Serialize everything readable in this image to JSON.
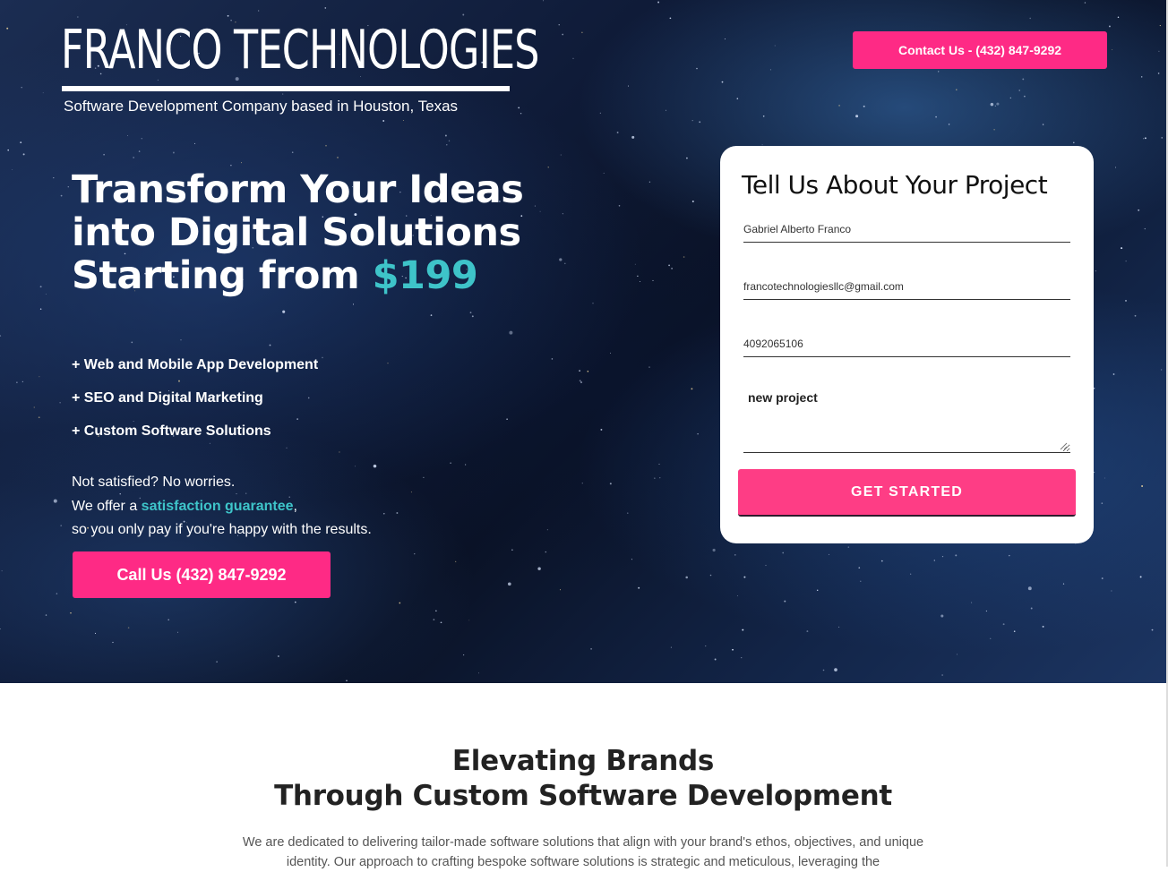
{
  "brand": {
    "name": "FRANCO TECHNOLOGIES",
    "tagline": "Software Development Company based in Houston, Texas"
  },
  "header": {
    "contact_label": "Contact Us - (432) 847-9292"
  },
  "hero": {
    "heading_line1": "Transform Your Ideas",
    "heading_line2": "into Digital Solutions",
    "heading_line3_prefix": "Starting from ",
    "heading_price": "$199",
    "services": [
      "+ Web and Mobile App Development",
      "+ SEO and Digital Marketing",
      "+ Custom Software Solutions"
    ],
    "guarantee_line1": "Not satisfied? No worries.",
    "guarantee_line2_prefix": "We offer a ",
    "guarantee_highlight": "satisfaction guarantee",
    "guarantee_line2_suffix": ",",
    "guarantee_line3": "so you only pay if you're happy with the results.",
    "call_label": "Call Us (432) 847-9292"
  },
  "form": {
    "title": "Tell Us About Your Project",
    "name_value": "Gabriel Alberto Franco",
    "email_value": "francotechnologiesllc@gmail.com",
    "phone_value": "4092065106",
    "message_value": "new project",
    "submit_label": "GET STARTED"
  },
  "about": {
    "heading_line1": "Elevating Brands",
    "heading_line2": "Through Custom Software Development",
    "text": "We are dedicated to delivering tailor-made software solutions that align with your brand's ethos, objectives, and unique identity. Our approach to crafting bespoke software solutions is strategic and meticulous, leveraging the"
  },
  "colors": {
    "accent_pink": "#fe2a85",
    "accent_teal": "#3ec4c9",
    "hero_bg": "#0f1b38"
  }
}
